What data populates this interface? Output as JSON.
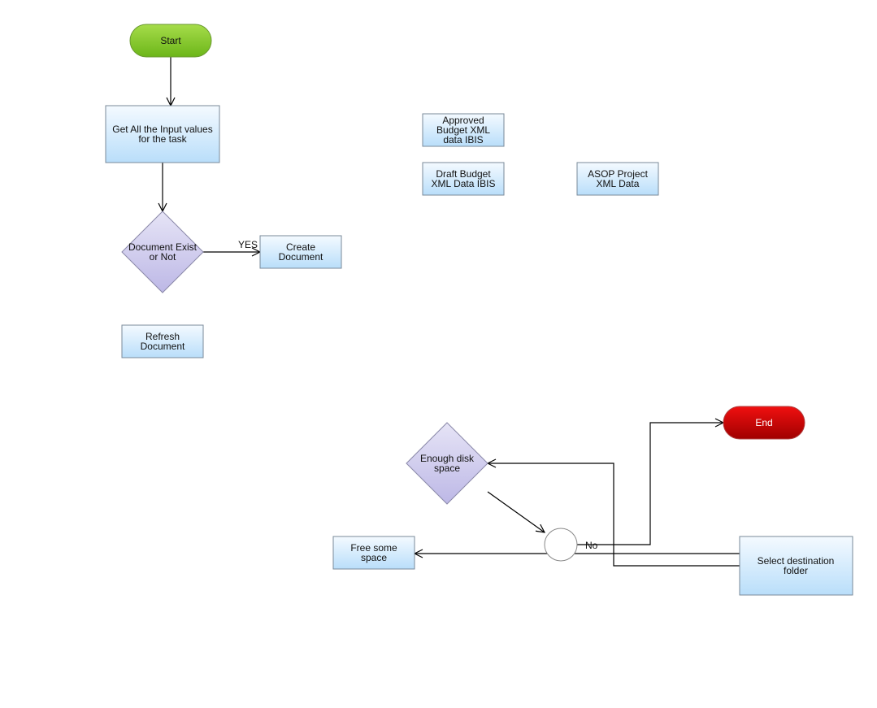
{
  "nodes": {
    "start": "Start",
    "get_inputs": [
      "Get All the Input values",
      "for the task"
    ],
    "document_exist": [
      "Document Exist",
      "or Not"
    ],
    "create_document": [
      "Create",
      "Document"
    ],
    "refresh_document": [
      "Refresh",
      "Document"
    ],
    "approved_budget": [
      "Approved",
      "Budget XML",
      "data IBIS"
    ],
    "draft_budget": [
      "Draft Budget",
      "XML Data IBIS"
    ],
    "asop_project": [
      "ASOP Project",
      "XML Data"
    ],
    "enough_disk": [
      "Enough disk",
      "space"
    ],
    "free_space": [
      "Free some",
      "space"
    ],
    "select_destination": [
      "Select destination",
      "folder"
    ],
    "end": "End"
  },
  "edge_labels": {
    "yes": "YES",
    "no": "No"
  },
  "colors": {
    "start": "#7cc520",
    "end": "#c00000",
    "process": "#c9e6fb",
    "decision": "#c7c3e8"
  }
}
